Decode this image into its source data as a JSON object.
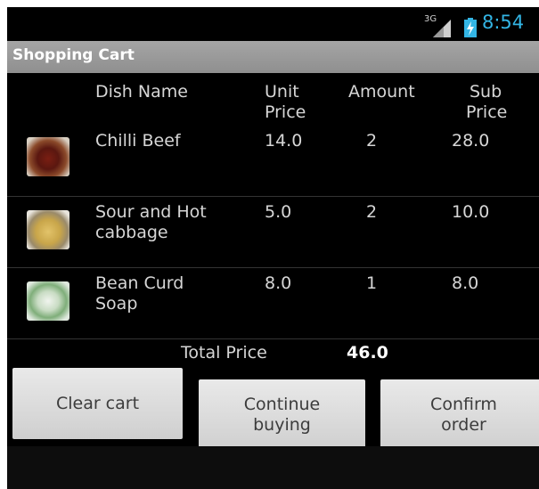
{
  "status_bar": {
    "network": "3G",
    "time": "8:54",
    "icons": [
      "signal-icon",
      "battery-icon"
    ]
  },
  "title": "Shopping Cart",
  "table": {
    "headers": {
      "dish_name": "Dish Name",
      "unit_price_1": "Unit",
      "unit_price_2": "Price",
      "amount": "Amount",
      "sub_price_1": "Sub",
      "sub_price_2": "Price"
    },
    "rows": [
      {
        "name_1": "Chilli Beef",
        "name_2": "",
        "unit_price": "14.0",
        "amount": "2",
        "sub_price": "28.0",
        "image": "chilli-beef"
      },
      {
        "name_1": "Sour and Hot",
        "name_2": "cabbage",
        "unit_price": "5.0",
        "amount": "2",
        "sub_price": "10.0",
        "image": "sour-hot-cabbage"
      },
      {
        "name_1": "Bean Curd",
        "name_2": "Soap",
        "unit_price": "8.0",
        "amount": "1",
        "sub_price": "8.0",
        "image": "bean-curd-soap"
      }
    ]
  },
  "total": {
    "label": "Total Price",
    "value": "46.0"
  },
  "buttons": {
    "clear": "Clear cart",
    "continue": "Continue\nbuying",
    "confirm": "Confirm\norder"
  },
  "colors": {
    "clock": "#33b5e5",
    "title_bar": "#9a9a9a",
    "background": "#000000",
    "button": "#dcdcdc"
  }
}
